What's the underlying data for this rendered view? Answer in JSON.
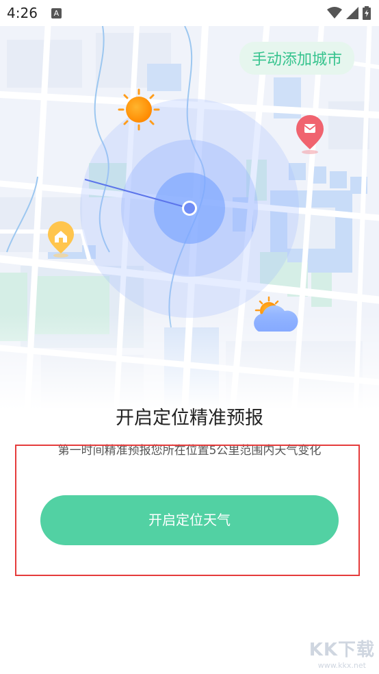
{
  "status_bar": {
    "time": "4:26",
    "notification_icon": "A"
  },
  "map": {
    "manual_add_label": "手动添加城市",
    "icons": [
      "sun-icon",
      "pin-icon",
      "home-pin-icon",
      "cloud-sun-icon",
      "location-dot-icon"
    ]
  },
  "content": {
    "title": "开启定位精准预报",
    "subtitle": "第一时间精准预报您所在位置5公里范围内天气变化",
    "enable_button_label": "开启定位天气"
  },
  "watermark": {
    "logo": "KK下载",
    "url": "www.kkx.net"
  },
  "colors": {
    "accent": "#52d1a3",
    "accent_text": "#35c38d",
    "highlight_border": "#e53b3b"
  }
}
